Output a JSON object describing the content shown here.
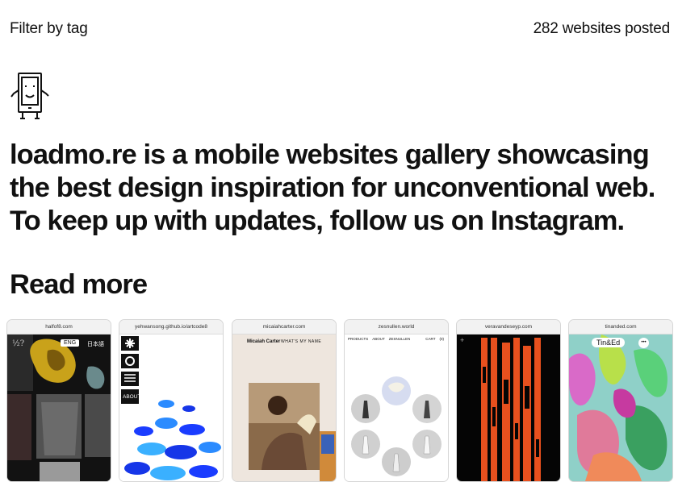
{
  "header": {
    "filter_label": "Filter by tag",
    "count_label": "282 websites posted"
  },
  "intro": {
    "text_before": "loadmo.re is a mobile websites gallery showcasing the best design inspiration for unconventional web. To keep up with updates, follow us on ",
    "link": "Instagram",
    "text_after": "."
  },
  "read_more": "Read more",
  "cards": [
    {
      "url": "halfof8.com",
      "lang_en": "ENG",
      "lang_jp": "日本語",
      "corner": "½?"
    },
    {
      "url": "yehwansong.github.io/artcode8",
      "menu_about": "ABOUT"
    },
    {
      "url": "micaiahcarter.com",
      "name": "Micaiah Carter",
      "nav": "WHAT'S  MY  NAME"
    },
    {
      "url": "zesnullen.world",
      "nav": [
        "PRODUCTS",
        "ABOUT",
        "ZESNULLEN",
        "CART",
        "(0)"
      ]
    },
    {
      "url": "veravandeseyp.com",
      "plus": "+"
    },
    {
      "url": "tinanded.com",
      "brand": "Tin&Ed",
      "dots": "•••"
    }
  ],
  "colors": {
    "text": "#111111",
    "background": "#ffffff",
    "card_border": "#d6d6d6"
  }
}
